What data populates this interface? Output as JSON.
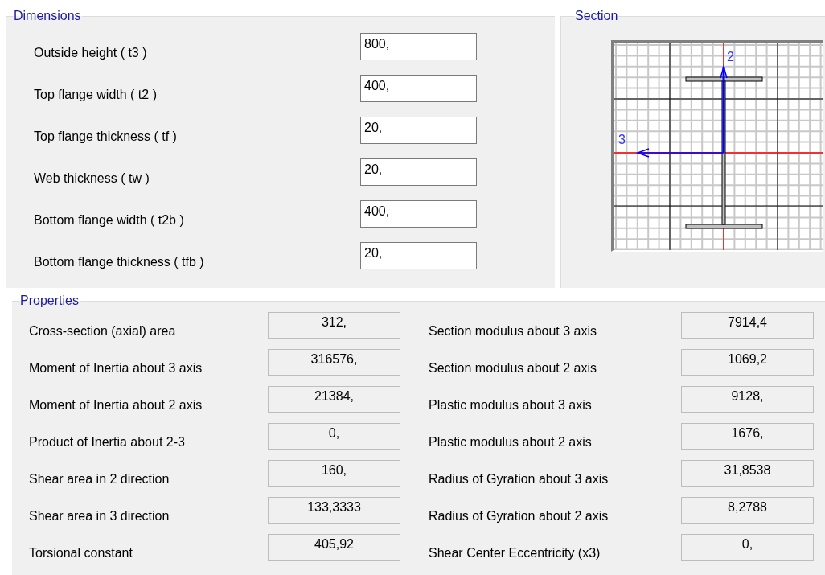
{
  "dimensions": {
    "title": "Dimensions",
    "fields": [
      {
        "label": "Outside height  ( t3 )",
        "value": "800,"
      },
      {
        "label": "Top flange width  ( t2 )",
        "value": "400,"
      },
      {
        "label": "Top flange thickness  ( tf )",
        "value": "20,"
      },
      {
        "label": "Web thickness  ( tw )",
        "value": "20,"
      },
      {
        "label": "Bottom flange width  ( t2b )",
        "value": "400,"
      },
      {
        "label": "Bottom flange thickness  ( tfb )",
        "value": "20,"
      }
    ]
  },
  "section": {
    "title": "Section",
    "axis_labels": [
      "2",
      "3"
    ]
  },
  "properties": {
    "title": "Properties",
    "left": [
      {
        "label": "Cross-section (axial) area",
        "value": "312,"
      },
      {
        "label": "Moment of Inertia about 3 axis",
        "value": "316576,"
      },
      {
        "label": "Moment of Inertia about 2 axis",
        "value": "21384,"
      },
      {
        "label": "Product of Inertia about 2-3",
        "value": "0,"
      },
      {
        "label": "Shear area in 2 direction",
        "value": "160,"
      },
      {
        "label": "Shear area in 3 direction",
        "value": "133,3333"
      },
      {
        "label": "Torsional constant",
        "value": "405,92"
      }
    ],
    "right": [
      {
        "label": "Section modulus about 3 axis",
        "value": "7914,4"
      },
      {
        "label": "Section modulus about 2 axis",
        "value": "1069,2"
      },
      {
        "label": "Plastic modulus about 3 axis",
        "value": "9128,"
      },
      {
        "label": "Plastic modulus about 2 axis",
        "value": "1676,"
      },
      {
        "label": "Radius of Gyration about 3 axis",
        "value": "31,8538"
      },
      {
        "label": "Radius of Gyration about 2 axis",
        "value": "8,2788"
      },
      {
        "label": "Shear Center Eccentricity (x3)",
        "value": "0,"
      }
    ]
  }
}
